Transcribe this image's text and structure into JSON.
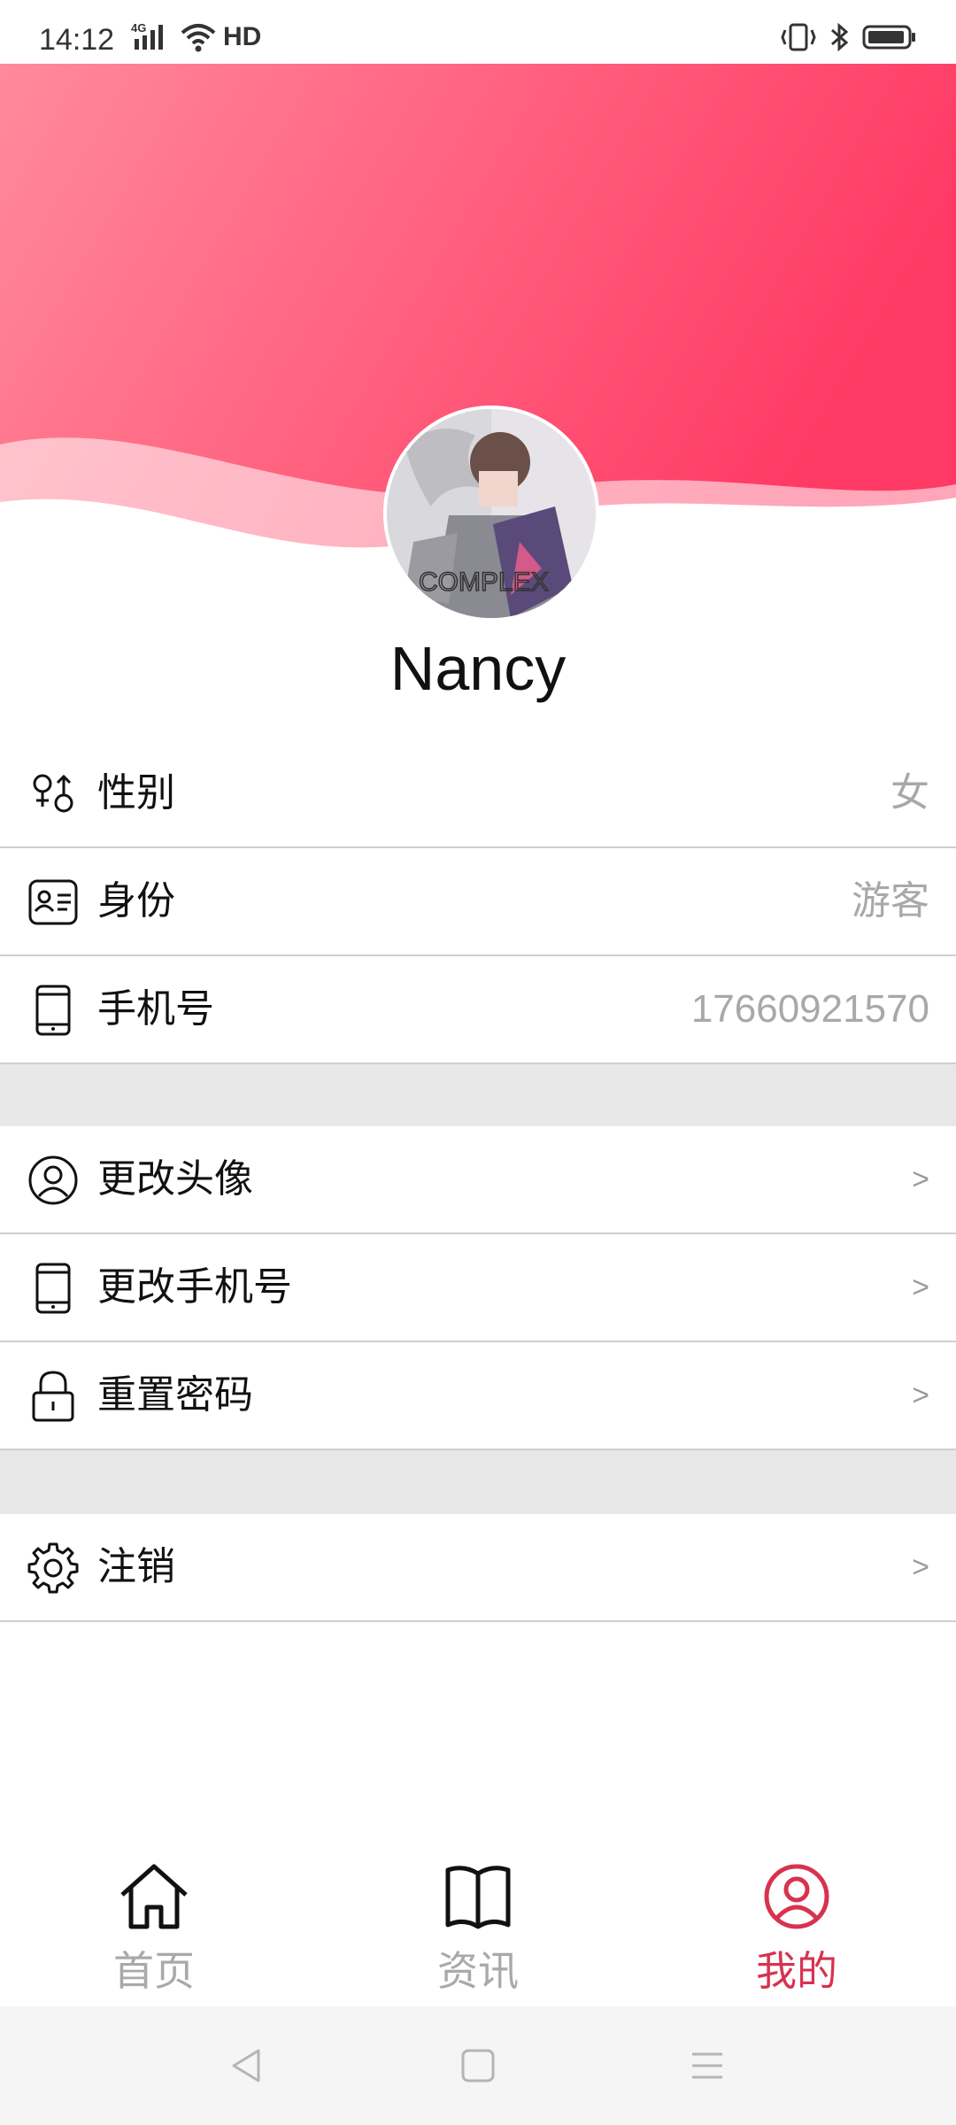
{
  "status_bar": {
    "time": "14:12",
    "network_badge": "4G",
    "hd_label": "HD",
    "icons": [
      "signal-icon",
      "wifi-icon",
      "vibrate-icon",
      "bluetooth-icon",
      "battery-icon"
    ]
  },
  "profile": {
    "username": "Nancy",
    "avatar_text": "COMPLEX"
  },
  "info_rows": [
    {
      "icon": "gender-icon",
      "label": "性别",
      "value": "女"
    },
    {
      "icon": "id-card-icon",
      "label": "身份",
      "value": "游客"
    },
    {
      "icon": "phone-icon",
      "label": "手机号",
      "value": "17660921570"
    }
  ],
  "action_rows": [
    {
      "icon": "user-circle-icon",
      "label": "更改头像",
      "chevron": ">"
    },
    {
      "icon": "phone-icon",
      "label": "更改手机号",
      "chevron": ">"
    },
    {
      "icon": "lock-icon",
      "label": "重置密码",
      "chevron": ">"
    }
  ],
  "logout_row": {
    "icon": "gear-icon",
    "label": "注销",
    "chevron": ">"
  },
  "tabbar": {
    "tabs": [
      {
        "icon": "home-icon",
        "label": "首页",
        "active": false
      },
      {
        "icon": "book-icon",
        "label": "资讯",
        "active": false
      },
      {
        "icon": "user-circle-icon",
        "label": "我的",
        "active": true
      }
    ]
  },
  "colors": {
    "header_gradient_start": "#ff8a99",
    "header_gradient_end": "#ff3a64",
    "accent": "#d8324f",
    "separator": "#e8e8e8",
    "secondary_text": "#a8a8a8"
  }
}
